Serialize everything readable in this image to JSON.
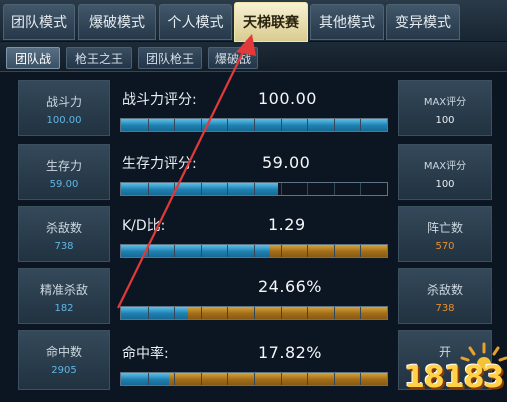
{
  "top_tabs": [
    {
      "label": "团队模式"
    },
    {
      "label": "爆破模式"
    },
    {
      "label": "个人模式"
    },
    {
      "label": "天梯联赛",
      "active": true
    },
    {
      "label": "其他模式"
    },
    {
      "label": "变异模式"
    }
  ],
  "sub_tabs": [
    {
      "label": "团队战",
      "active": true
    },
    {
      "label": "枪王之王"
    },
    {
      "label": "团队枪王"
    },
    {
      "label": "爆破战"
    }
  ],
  "left_boxes": [
    {
      "title": "战斗力",
      "value": "100.00"
    },
    {
      "title": "生存力",
      "value": "59.00"
    },
    {
      "title": "杀敌数",
      "value": "738"
    },
    {
      "title": "精准杀敌",
      "value": "182"
    },
    {
      "title": "命中数",
      "value": "2905"
    }
  ],
  "stats": [
    {
      "label": "战斗力评分:",
      "value": "100.00",
      "blue_fraction": 1.0,
      "gold_fraction": 0.0
    },
    {
      "label": "生存力评分:",
      "value": "59.00",
      "blue_fraction": 0.59,
      "gold_fraction": 0.0
    },
    {
      "label": "K/D比:",
      "value": "1.29",
      "blue_fraction": 0.56,
      "gold_fraction": 0.44
    },
    {
      "label": "",
      "value": "24.66%",
      "blue_fraction": 0.25,
      "gold_fraction": 0.75
    },
    {
      "label": "命中率:",
      "value": "17.82%",
      "blue_fraction": 0.18,
      "gold_fraction": 0.82
    }
  ],
  "right_boxes": [
    {
      "title": "MAX评分",
      "value": "100",
      "value_color": "white"
    },
    {
      "title": "MAX评分",
      "value": "100",
      "value_color": "white"
    },
    {
      "title": "阵亡数",
      "value": "570",
      "value_color": "orange"
    },
    {
      "title": "杀敌数",
      "value": "738",
      "value_color": "orange"
    },
    {
      "title": "开",
      "value": "",
      "value_color": "white"
    }
  ],
  "watermark": {
    "text": "18183"
  },
  "colors": {
    "active_tab": "#f1e6a8",
    "bar_blue": "#2a93c8",
    "bar_gold": "#b07a22",
    "arrow_red": "#e23a3a",
    "left_value": "#5fb6e6",
    "orange_value": "#e88f2e"
  },
  "icons": {
    "arrow": "red-pointer-arrow-icon",
    "logo": "18183-logo-icon"
  }
}
